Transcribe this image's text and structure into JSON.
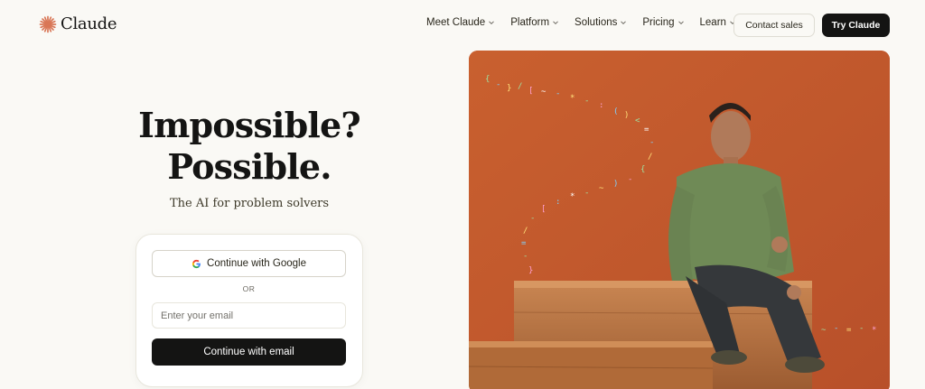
{
  "brand": {
    "name": "Claude",
    "accent": "#d97757"
  },
  "nav": {
    "items": [
      {
        "label": "Meet Claude"
      },
      {
        "label": "Platform"
      },
      {
        "label": "Solutions"
      },
      {
        "label": "Pricing"
      },
      {
        "label": "Learn"
      }
    ],
    "contact_label": "Contact sales",
    "try_label": "Try Claude"
  },
  "hero": {
    "headline_line1": "Impossible?",
    "headline_line2": "Possible.",
    "tagline": "The AI for problem solvers",
    "image_background": "#c45a2c"
  },
  "signup": {
    "google_label": "Continue with Google",
    "or_label": "OR",
    "email_placeholder": "Enter your email",
    "email_button_label": "Continue with email"
  },
  "icons": [
    "claude-logo-icon",
    "chevron-down-icon",
    "google-icon"
  ]
}
